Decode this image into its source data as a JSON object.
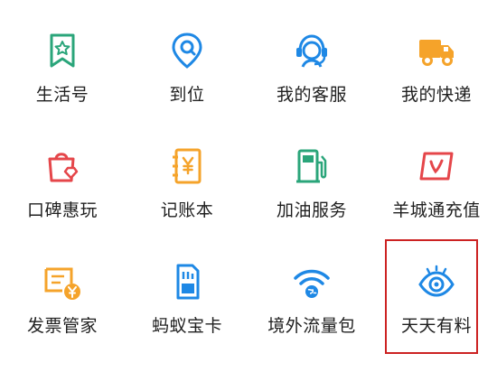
{
  "grid": {
    "items": [
      {
        "label": "生活号",
        "icon": "bookmark-star-icon"
      },
      {
        "label": "到位",
        "icon": "location-pin-icon"
      },
      {
        "label": "我的客服",
        "icon": "customer-service-icon"
      },
      {
        "label": "我的快递",
        "icon": "delivery-truck-icon"
      },
      {
        "label": "口碑惠玩",
        "icon": "shopping-bag-icon"
      },
      {
        "label": "记账本",
        "icon": "ledger-yen-icon"
      },
      {
        "label": "加油服务",
        "icon": "fuel-pump-icon"
      },
      {
        "label": "羊城通充值",
        "icon": "transit-card-icon"
      },
      {
        "label": "发票管家",
        "icon": "invoice-yen-icon"
      },
      {
        "label": "蚂蚁宝卡",
        "icon": "sim-card-icon"
      },
      {
        "label": "境外流量包",
        "icon": "wifi-globe-icon"
      },
      {
        "label": "天天有料",
        "icon": "eye-icon"
      }
    ]
  },
  "colors": {
    "green": "#2aa57a",
    "blue": "#1e88e5",
    "orange": "#f5a32a",
    "red": "#e5464a",
    "highlight": "#cc2222"
  }
}
